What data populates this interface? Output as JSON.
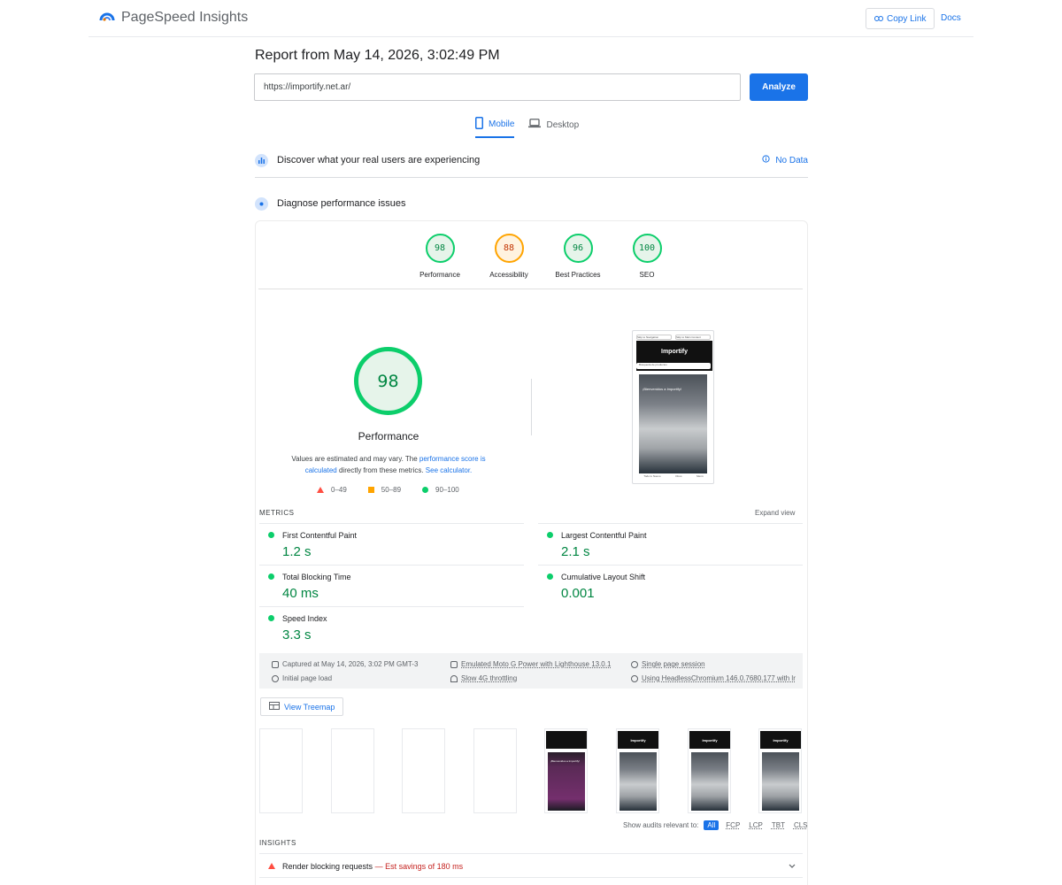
{
  "app": {
    "title": "PageSpeed Insights",
    "copy_link": "Copy Link",
    "docs": "Docs"
  },
  "report": {
    "title": "Report from May 14, 2026, 3:02:49 PM",
    "url": "https://importify.net.ar/",
    "analyze": "Analyze"
  },
  "tabs": [
    {
      "label": "Mobile",
      "active": true
    },
    {
      "label": "Desktop",
      "active": false
    }
  ],
  "sections": {
    "discover": "Discover what your real users are experiencing",
    "no_data": "No Data",
    "diagnose": "Diagnose performance issues"
  },
  "scores": [
    {
      "label": "Performance",
      "value": "98",
      "status": "pass"
    },
    {
      "label": "Accessibility",
      "value": "88",
      "status": "average"
    },
    {
      "label": "Best Practices",
      "value": "96",
      "status": "pass"
    },
    {
      "label": "SEO",
      "value": "100",
      "status": "pass"
    }
  ],
  "perf": {
    "score": "98",
    "label": "Performance",
    "desc_pre": "Values are estimated and may vary. The ",
    "desc_link1": "performance score is calculated",
    "desc_mid": " directly from these metrics. ",
    "desc_link2": "See calculator.",
    "legend": [
      "0–49",
      "50–89",
      "90–100"
    ]
  },
  "screenshot": {
    "skip_nav": "Skip to Navigation",
    "skip_main": "Skip to Main Content",
    "logo": "Importify",
    "search": "Búsqueda de productos",
    "hero": "¡Bienvenidos a Importify!",
    "nav": [
      "Todo lo Nuevo",
      "Otros",
      "Menú"
    ]
  },
  "metrics": {
    "title": "METRICS",
    "expand": "Expand view",
    "items": [
      {
        "label": "First Contentful Paint",
        "value": "1.2 s"
      },
      {
        "label": "Largest Contentful Paint",
        "value": "2.1 s"
      },
      {
        "label": "Total Blocking Time",
        "value": "40 ms"
      },
      {
        "label": "Cumulative Layout Shift",
        "value": "0.001"
      },
      {
        "label": "Speed Index",
        "value": "3.3 s"
      }
    ]
  },
  "env": {
    "captured": "Captured at May 14, 2026, 3:02 PM GMT-3",
    "initial": "Initial page load",
    "device": "Emulated Moto G Power with Lighthouse 13.0.1",
    "throttling": "Slow 4G throttling",
    "session": "Single page session",
    "browser": "Using HeadlessChromium 146.0.7680.177 with lr"
  },
  "treemap": "View Treemap",
  "filmstrip": {
    "logo": "Importify",
    "purple_caption": "¡Bienvenidos a Importify!"
  },
  "audits_filter": {
    "label": "Show audits relevant to:",
    "options": [
      "All",
      "FCP",
      "LCP",
      "TBT",
      "CLS"
    ]
  },
  "insights": {
    "title": "INSIGHTS",
    "items": [
      {
        "label": "Render blocking requests",
        "savings": " — Est savings of 180 ms"
      }
    ]
  },
  "colors": {
    "accent": "#1a73e8",
    "pass": "#0cce6b",
    "pass_text": "#018642",
    "average": "#ffa400",
    "fail": "#ff4e42"
  }
}
